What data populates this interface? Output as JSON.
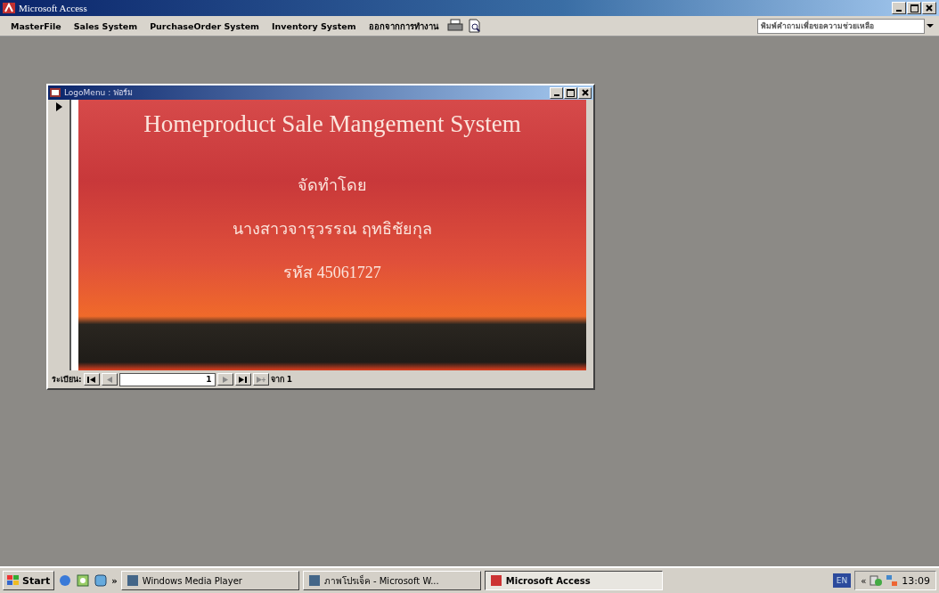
{
  "app_window": {
    "title": "Microsoft Access"
  },
  "menu_bar": {
    "items": [
      "MasterFile",
      "Sales System",
      "PurchaseOrder System",
      "Inventory System",
      "ออกจากการทำงาน"
    ],
    "help_box": {
      "placeholder": "พิมพ์คำถามเพื่อขอความช่วยเหลือ"
    }
  },
  "form_window": {
    "title": "LogoMenu : ฟอร์ม",
    "heading": "Homeproduct Sale Mangement System",
    "credit_label": "จัดทำโดย",
    "author": "นางสาวจารุวรรณ ฤทธิชัยกุล",
    "student_id": "รหัส 45061727",
    "record_nav": {
      "label": "ระเบียน:",
      "current": "1",
      "total": "จาก 1"
    }
  },
  "taskbar": {
    "start": "Start",
    "quick_launch_more": "»",
    "tray_expand": "«",
    "tasks": [
      {
        "label": "Windows Media Player",
        "selected": false
      },
      {
        "label": "ภาพโปรเจ็ค - Microsoft W...",
        "selected": false
      },
      {
        "label": "Microsoft Access",
        "selected": true
      }
    ],
    "language": "EN",
    "clock": "13:09"
  }
}
